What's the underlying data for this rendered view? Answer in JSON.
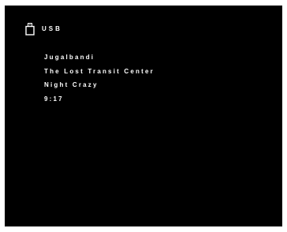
{
  "header": {
    "source_icon": "usb-icon",
    "source_label": "USB"
  },
  "track": {
    "album": "Jugalbandi",
    "title": "The Lost Transit Center",
    "artist": "Night Crazy",
    "time": "9:17"
  },
  "colors": {
    "background": "#000000",
    "text": "#ffffff",
    "frame": "#ffffff"
  }
}
